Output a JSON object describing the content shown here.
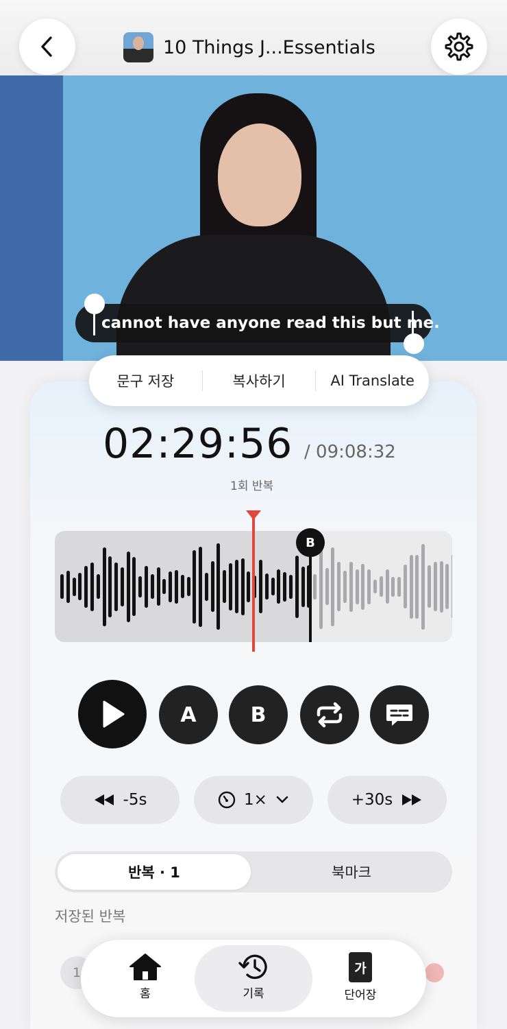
{
  "header": {
    "title": "10 Things J...Essentials"
  },
  "video": {
    "caption": "cannot have anyone read this but me."
  },
  "selection_menu": {
    "items": [
      "문구 저장",
      "복사하기",
      "AI Translate"
    ]
  },
  "player": {
    "current_time": "02:29:56",
    "total_time": "/ 09:08:32",
    "repeat_count": "1회 반복",
    "b_marker": "B",
    "controls": {
      "a_label": "A",
      "b_label": "B"
    },
    "skip_back_label": "-5s",
    "speed_label": "1×",
    "skip_forward_label": "+30s",
    "playback_progress": 0.499,
    "accent_color": "#e0483e"
  },
  "tabs": {
    "active_label": "반복 · 1",
    "inactive_label": "북마크"
  },
  "section": {
    "label": "저장된 반복"
  },
  "list": {
    "first_row_number": "1"
  },
  "bottom_nav": {
    "items": [
      {
        "label": "홈",
        "icon": "home-icon"
      },
      {
        "label": "기록",
        "icon": "history-icon"
      },
      {
        "label": "단어장",
        "icon": "vocab-book-icon"
      }
    ],
    "vocab_glyph": "가",
    "active_index": 1
  }
}
